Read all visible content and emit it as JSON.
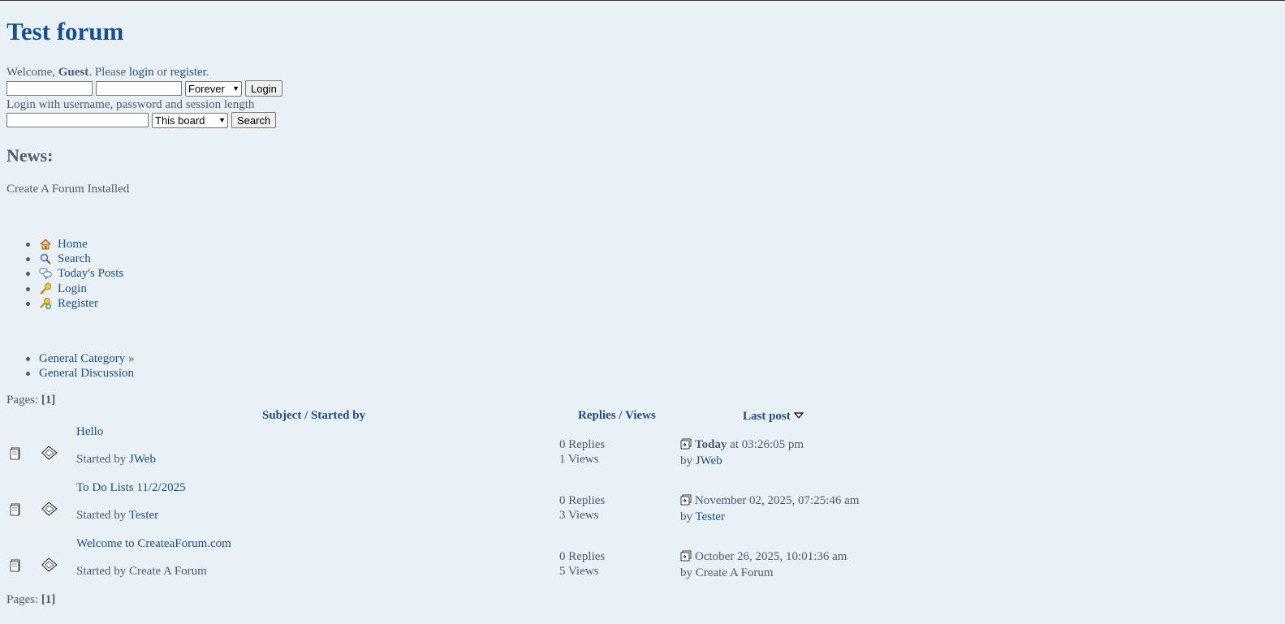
{
  "site": {
    "title": "Test forum"
  },
  "welcome": {
    "prefix": "Welcome, ",
    "user": "Guest",
    "middle": ". Please ",
    "login_link": "login",
    "or": " or ",
    "register_link": "register",
    "end": "."
  },
  "login_form": {
    "username_value": "",
    "password_value": "",
    "session_length": "Forever",
    "login_button": "Login",
    "hint": "Login with username, password and session length"
  },
  "search_form": {
    "query_value": "",
    "scope": "This board",
    "search_button": "Search"
  },
  "news": {
    "heading": "News:",
    "text": "Create A Forum Installed"
  },
  "menu": [
    {
      "label": "Home",
      "icon": "home-icon"
    },
    {
      "label": "Search",
      "icon": "search-icon"
    },
    {
      "label": "Today's Posts",
      "icon": "chat-bubbles-icon"
    },
    {
      "label": "Login",
      "icon": "key-icon"
    },
    {
      "label": "Register",
      "icon": "key-add-icon"
    }
  ],
  "breadcrumb": {
    "category": "General Category",
    "separator": " »",
    "board": "General Discussion"
  },
  "pagination": {
    "label": "Pages: ",
    "current": "[1]"
  },
  "table_headers": {
    "subject": "Subject",
    "slash1": " / ",
    "started_by": "Started by",
    "replies": "Replies",
    "slash2": " / ",
    "views": "Views",
    "last_post": "Last post"
  },
  "topics": [
    {
      "subject": "Hello",
      "started_prefix": "Started by ",
      "starter": "JWeb",
      "starter_is_link": true,
      "replies": "0 Replies",
      "views": "1 Views",
      "last_bold": "Today",
      "last_time": " at 03:26:05 pm",
      "by_prefix": "by ",
      "last_by": "JWeb",
      "last_by_is_link": true
    },
    {
      "subject": "To Do Lists 11/2/2025",
      "started_prefix": "Started by ",
      "starter": "Tester",
      "starter_is_link": true,
      "replies": "0 Replies",
      "views": "3 Views",
      "last_bold": "",
      "last_time": "November 02, 2025, 07:25:46 am",
      "by_prefix": "by ",
      "last_by": "Tester",
      "last_by_is_link": true
    },
    {
      "subject": "Welcome to CreateaForum.com",
      "started_prefix": "Started by ",
      "starter": "Create A Forum",
      "starter_is_link": false,
      "replies": "0 Replies",
      "views": "5 Views",
      "last_bold": "",
      "last_time": "October 26, 2025, 10:01:36 am",
      "by_prefix": "by ",
      "last_by": "Create A Forum",
      "last_by_is_link": false
    }
  ]
}
